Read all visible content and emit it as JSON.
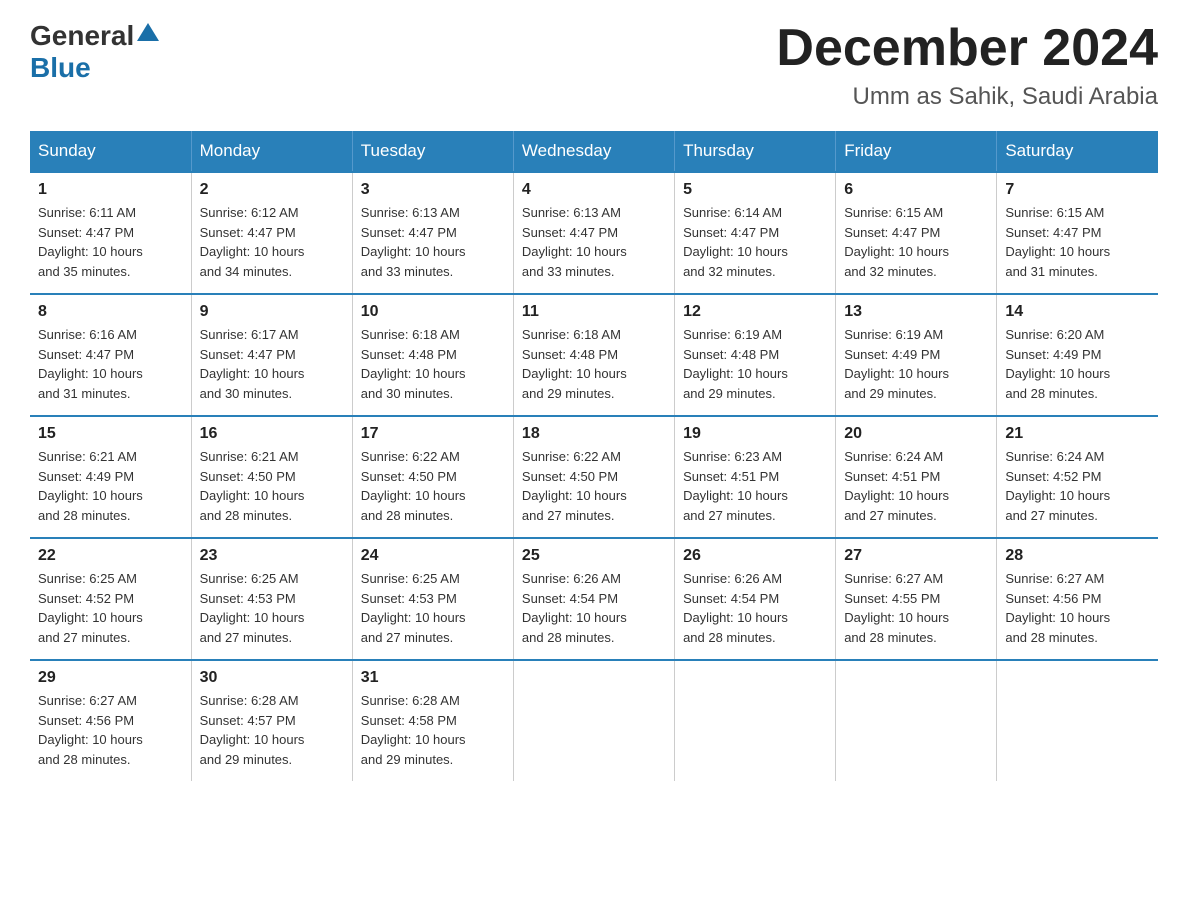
{
  "header": {
    "logo": {
      "general": "General",
      "blue": "Blue"
    },
    "title": "December 2024",
    "location": "Umm as Sahik, Saudi Arabia"
  },
  "days_of_week": [
    "Sunday",
    "Monday",
    "Tuesday",
    "Wednesday",
    "Thursday",
    "Friday",
    "Saturday"
  ],
  "weeks": [
    [
      {
        "day": "1",
        "sunrise": "6:11 AM",
        "sunset": "4:47 PM",
        "daylight_h": "10",
        "daylight_m": "35"
      },
      {
        "day": "2",
        "sunrise": "6:12 AM",
        "sunset": "4:47 PM",
        "daylight_h": "10",
        "daylight_m": "34"
      },
      {
        "day": "3",
        "sunrise": "6:13 AM",
        "sunset": "4:47 PM",
        "daylight_h": "10",
        "daylight_m": "33"
      },
      {
        "day": "4",
        "sunrise": "6:13 AM",
        "sunset": "4:47 PM",
        "daylight_h": "10",
        "daylight_m": "33"
      },
      {
        "day": "5",
        "sunrise": "6:14 AM",
        "sunset": "4:47 PM",
        "daylight_h": "10",
        "daylight_m": "32"
      },
      {
        "day": "6",
        "sunrise": "6:15 AM",
        "sunset": "4:47 PM",
        "daylight_h": "10",
        "daylight_m": "32"
      },
      {
        "day": "7",
        "sunrise": "6:15 AM",
        "sunset": "4:47 PM",
        "daylight_h": "10",
        "daylight_m": "31"
      }
    ],
    [
      {
        "day": "8",
        "sunrise": "6:16 AM",
        "sunset": "4:47 PM",
        "daylight_h": "10",
        "daylight_m": "31"
      },
      {
        "day": "9",
        "sunrise": "6:17 AM",
        "sunset": "4:47 PM",
        "daylight_h": "10",
        "daylight_m": "30"
      },
      {
        "day": "10",
        "sunrise": "6:18 AM",
        "sunset": "4:48 PM",
        "daylight_h": "10",
        "daylight_m": "30"
      },
      {
        "day": "11",
        "sunrise": "6:18 AM",
        "sunset": "4:48 PM",
        "daylight_h": "10",
        "daylight_m": "29"
      },
      {
        "day": "12",
        "sunrise": "6:19 AM",
        "sunset": "4:48 PM",
        "daylight_h": "10",
        "daylight_m": "29"
      },
      {
        "day": "13",
        "sunrise": "6:19 AM",
        "sunset": "4:49 PM",
        "daylight_h": "10",
        "daylight_m": "29"
      },
      {
        "day": "14",
        "sunrise": "6:20 AM",
        "sunset": "4:49 PM",
        "daylight_h": "10",
        "daylight_m": "28"
      }
    ],
    [
      {
        "day": "15",
        "sunrise": "6:21 AM",
        "sunset": "4:49 PM",
        "daylight_h": "10",
        "daylight_m": "28"
      },
      {
        "day": "16",
        "sunrise": "6:21 AM",
        "sunset": "4:50 PM",
        "daylight_h": "10",
        "daylight_m": "28"
      },
      {
        "day": "17",
        "sunrise": "6:22 AM",
        "sunset": "4:50 PM",
        "daylight_h": "10",
        "daylight_m": "28"
      },
      {
        "day": "18",
        "sunrise": "6:22 AM",
        "sunset": "4:50 PM",
        "daylight_h": "10",
        "daylight_m": "27"
      },
      {
        "day": "19",
        "sunrise": "6:23 AM",
        "sunset": "4:51 PM",
        "daylight_h": "10",
        "daylight_m": "27"
      },
      {
        "day": "20",
        "sunrise": "6:24 AM",
        "sunset": "4:51 PM",
        "daylight_h": "10",
        "daylight_m": "27"
      },
      {
        "day": "21",
        "sunrise": "6:24 AM",
        "sunset": "4:52 PM",
        "daylight_h": "10",
        "daylight_m": "27"
      }
    ],
    [
      {
        "day": "22",
        "sunrise": "6:25 AM",
        "sunset": "4:52 PM",
        "daylight_h": "10",
        "daylight_m": "27"
      },
      {
        "day": "23",
        "sunrise": "6:25 AM",
        "sunset": "4:53 PM",
        "daylight_h": "10",
        "daylight_m": "27"
      },
      {
        "day": "24",
        "sunrise": "6:25 AM",
        "sunset": "4:53 PM",
        "daylight_h": "10",
        "daylight_m": "27"
      },
      {
        "day": "25",
        "sunrise": "6:26 AM",
        "sunset": "4:54 PM",
        "daylight_h": "10",
        "daylight_m": "28"
      },
      {
        "day": "26",
        "sunrise": "6:26 AM",
        "sunset": "4:54 PM",
        "daylight_h": "10",
        "daylight_m": "28"
      },
      {
        "day": "27",
        "sunrise": "6:27 AM",
        "sunset": "4:55 PM",
        "daylight_h": "10",
        "daylight_m": "28"
      },
      {
        "day": "28",
        "sunrise": "6:27 AM",
        "sunset": "4:56 PM",
        "daylight_h": "10",
        "daylight_m": "28"
      }
    ],
    [
      {
        "day": "29",
        "sunrise": "6:27 AM",
        "sunset": "4:56 PM",
        "daylight_h": "10",
        "daylight_m": "28"
      },
      {
        "day": "30",
        "sunrise": "6:28 AM",
        "sunset": "4:57 PM",
        "daylight_h": "10",
        "daylight_m": "29"
      },
      {
        "day": "31",
        "sunrise": "6:28 AM",
        "sunset": "4:58 PM",
        "daylight_h": "10",
        "daylight_m": "29"
      },
      null,
      null,
      null,
      null
    ]
  ],
  "labels": {
    "sunrise": "Sunrise:",
    "sunset": "Sunset:",
    "daylight": "Daylight:",
    "and": "and",
    "minutes": "minutes."
  }
}
